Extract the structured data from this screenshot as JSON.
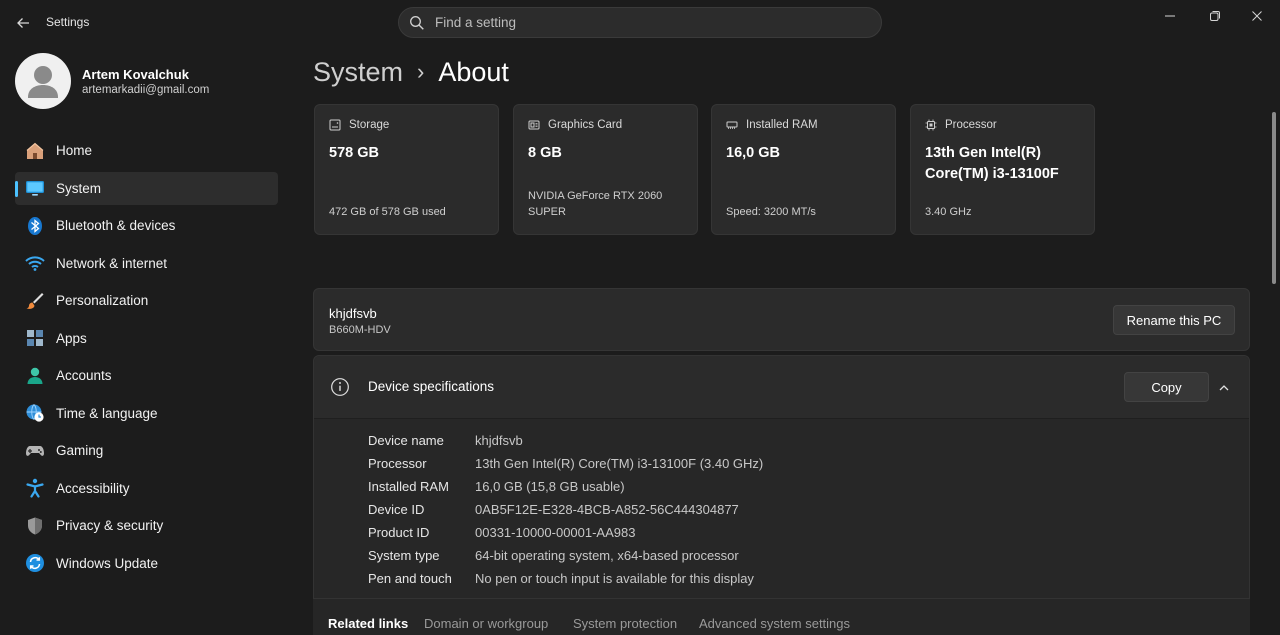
{
  "window": {
    "title": "Settings",
    "back_icon": "arrow-left-icon",
    "controls": [
      "minimize-icon",
      "restore-icon",
      "close-icon"
    ]
  },
  "search": {
    "placeholder": "Find a setting",
    "icon": "search-icon"
  },
  "profile": {
    "name": "Artem Kovalchuk",
    "email": "artemarkadii@gmail.com"
  },
  "sidebar": {
    "items": [
      {
        "label": "Home",
        "icon": "home-icon",
        "active": false
      },
      {
        "label": "System",
        "icon": "monitor-icon",
        "active": true
      },
      {
        "label": "Bluetooth & devices",
        "icon": "bluetooth-icon",
        "active": false
      },
      {
        "label": "Network & internet",
        "icon": "wifi-icon",
        "active": false
      },
      {
        "label": "Personalization",
        "icon": "brush-icon",
        "active": false
      },
      {
        "label": "Apps",
        "icon": "apps-icon",
        "active": false
      },
      {
        "label": "Accounts",
        "icon": "person-icon",
        "active": false
      },
      {
        "label": "Time & language",
        "icon": "globe-clock-icon",
        "active": false
      },
      {
        "label": "Gaming",
        "icon": "gamepad-icon",
        "active": false
      },
      {
        "label": "Accessibility",
        "icon": "accessibility-icon",
        "active": false
      },
      {
        "label": "Privacy & security",
        "icon": "shield-icon",
        "active": false
      },
      {
        "label": "Windows Update",
        "icon": "update-icon",
        "active": false
      }
    ]
  },
  "breadcrumb": {
    "parent": "System",
    "separator": "›",
    "current": "About"
  },
  "cards": [
    {
      "label": "Storage",
      "value": "578 GB",
      "detail": "472 GB of 578 GB used",
      "icon": "storage-icon"
    },
    {
      "label": "Graphics Card",
      "value": "8 GB",
      "detail": "NVIDIA GeForce RTX 2060 SUPER",
      "icon": "gpu-icon"
    },
    {
      "label": "Installed RAM",
      "value": "16,0 GB",
      "detail": "Speed: 3200 MT/s",
      "icon": "ram-icon"
    },
    {
      "label": "Processor",
      "value": "13th Gen Intel(R) Core(TM) i3-13100F",
      "detail": "3.40 GHz",
      "icon": "processor-icon"
    }
  ],
  "pc": {
    "name": "khjdfsvb",
    "model": "B660M-HDV",
    "rename_label": "Rename this PC"
  },
  "specs": {
    "title": "Device specifications",
    "copy_label": "Copy",
    "rows": [
      {
        "key": "Device name",
        "value": "khjdfsvb"
      },
      {
        "key": "Processor",
        "value": "13th Gen Intel(R) Core(TM) i3-13100F (3.40 GHz)"
      },
      {
        "key": "Installed RAM",
        "value": "16,0 GB (15,8 GB usable)"
      },
      {
        "key": "Device ID",
        "value": "0AB5F12E-E328-4BCB-A852-56C444304877"
      },
      {
        "key": "Product ID",
        "value": "00331-10000-00001-AA983"
      },
      {
        "key": "System type",
        "value": "64-bit operating system, x64-based processor"
      },
      {
        "key": "Pen and touch",
        "value": "No pen or touch input is available for this display"
      }
    ]
  },
  "related": {
    "title": "Related links",
    "links": [
      "Domain or workgroup",
      "System protection",
      "Advanced system settings"
    ]
  }
}
